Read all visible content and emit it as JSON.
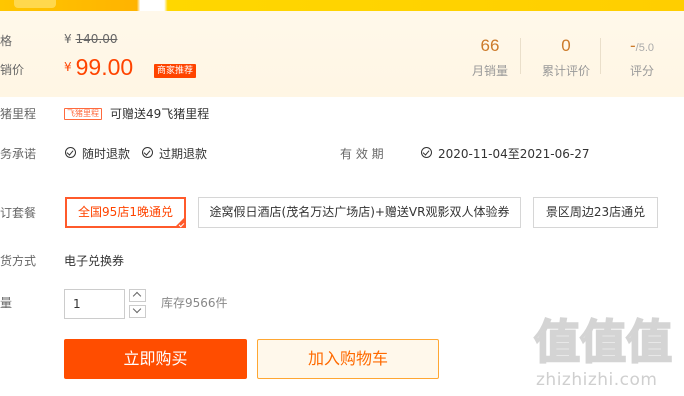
{
  "price": {
    "orig_label": "格",
    "orig_currency": "¥",
    "orig_value": "140.00",
    "sale_label": "销价",
    "sale_currency": "¥",
    "sale_value": "99.00",
    "badge": "商家推荐"
  },
  "stats": [
    {
      "value": "66",
      "label": "月销量"
    },
    {
      "value": "0",
      "label": "累计评价"
    },
    {
      "value": "-",
      "suffix": "/5.0",
      "label": "评分"
    }
  ],
  "miles": {
    "label": "猪里程",
    "badge": "飞猪里程",
    "text": "可赠送49飞猪里程"
  },
  "service": {
    "label": "务承诺",
    "items": [
      "随时退款",
      "过期退款"
    ],
    "validity_label": "有 效 期",
    "validity_value": "2020-11-04至2021-06-27"
  },
  "packages": {
    "label": "订套餐",
    "options": [
      {
        "label": "全国95店1晚通兑",
        "selected": true
      },
      {
        "label": "途窝假日酒店(茂名万达广场店)+赠送VR观影双人体验券",
        "selected": false
      },
      {
        "label": "景区周边23店通兑",
        "selected": false
      }
    ]
  },
  "delivery": {
    "label": "货方式",
    "value": "电子兑换券"
  },
  "quantity": {
    "label": "量",
    "value": "1",
    "stock": "库存9566件"
  },
  "actions": {
    "buy": "立即购买",
    "cart": "加入购物车"
  },
  "watermark": {
    "glyphs": [
      "值",
      "值",
      "值"
    ],
    "text": "zhizhizhi.com"
  },
  "colors": {
    "accent": "#ff4400",
    "badge_bg": "#ff4400",
    "stat_value": "#cc7a2a",
    "panel_bg": "#fff8ea",
    "cart_border": "#ffa733"
  }
}
